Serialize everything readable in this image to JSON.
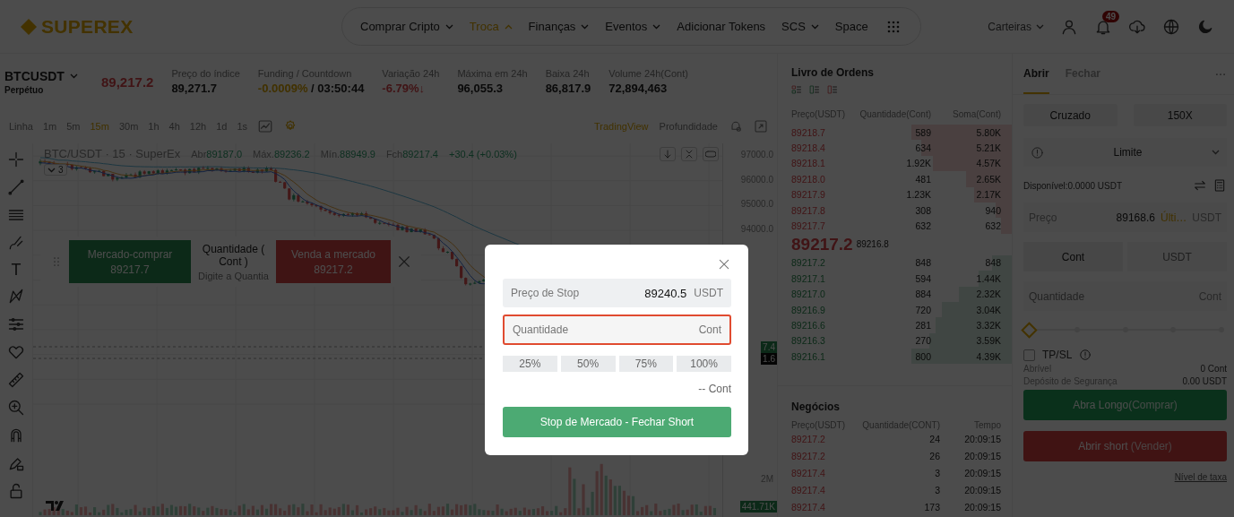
{
  "header": {
    "logo": "SUPEREX",
    "nav": [
      {
        "label": "Comprar Cripto",
        "dropdown": true,
        "selected": false
      },
      {
        "label": "Troca",
        "dropdown": true,
        "selected": true
      },
      {
        "label": "Finanças",
        "dropdown": true,
        "selected": false
      },
      {
        "label": "Eventos",
        "dropdown": true,
        "selected": false
      },
      {
        "label": "Adicionar Tokens",
        "dropdown": false,
        "selected": false
      },
      {
        "label": "SCS",
        "dropdown": true,
        "selected": false
      },
      {
        "label": "Space",
        "dropdown": false,
        "selected": false
      }
    ],
    "wallets": "Carteiras",
    "notification_count": "49"
  },
  "ticker": {
    "symbol": "BTCUSDT",
    "contract_type": "Perpétuo",
    "last_price": "89,217.2",
    "stats": [
      {
        "label": "Preço do índice",
        "value": "89,271.7",
        "kind": "plain"
      },
      {
        "label": "Funding / Countdown",
        "value": "-0.0009%",
        "suffix": "/ 03:50:44",
        "kind": "funding"
      },
      {
        "label": "Variação 24h",
        "value": "-6.79%↓",
        "kind": "down"
      },
      {
        "label": "Máxima em 24h",
        "value": "96,055.3",
        "kind": "plain"
      },
      {
        "label": "Baixa 24h",
        "value": "86,817.9",
        "kind": "plain"
      },
      {
        "label": "Volume 24h(Cont)",
        "value": "72,894,463",
        "kind": "plain"
      }
    ]
  },
  "chart": {
    "intervals": [
      {
        "label": "Linha",
        "selected": false
      },
      {
        "label": "1m",
        "selected": false
      },
      {
        "label": "5m",
        "selected": false
      },
      {
        "label": "15m",
        "selected": true
      },
      {
        "label": "30m",
        "selected": false
      },
      {
        "label": "1h",
        "selected": false
      },
      {
        "label": "4h",
        "selected": false
      },
      {
        "label": "12h",
        "selected": false
      },
      {
        "label": "1d",
        "selected": false
      },
      {
        "label": "1s",
        "selected": false
      }
    ],
    "views": [
      {
        "label": "TradingView",
        "selected": true
      },
      {
        "label": "Profundidade",
        "selected": false
      }
    ],
    "legend": {
      "title": "BTC/USDT · 15 · SuperEx",
      "ohlc": [
        {
          "label": "Abr",
          "value": "89187.0"
        },
        {
          "label": "Máx.",
          "value": "89236.2"
        },
        {
          "label": "Mín.",
          "value": "88949.9"
        },
        {
          "label": "Fch",
          "value": "89217.4"
        }
      ],
      "change": "+30.4 (+0.03%)"
    },
    "indicators_count": "3",
    "text_tool": "T",
    "price_axis": [
      "97000.0",
      "96000.0",
      "95000.0",
      "94000.0"
    ],
    "price_tags": [
      {
        "text": "7.4",
        "kind": "up"
      },
      {
        "text": "1.6",
        "kind": "dark"
      }
    ],
    "volume_axis": "2M",
    "volume_tag": "441.71K",
    "quick_trade": {
      "buy_label": "Mercado-comprar",
      "buy_price": "89217.7",
      "qty_label": "Quantidade ( Cont )",
      "qty_placeholder": "Digite a Quantia",
      "sell_label": "Venda a mercado",
      "sell_price": "89217.2"
    }
  },
  "order_book": {
    "title": "Livro de Ordens",
    "columns": [
      "Preço(USDT)",
      "Quantidade(Cont)",
      "Soma(Cont)"
    ],
    "asks": [
      {
        "price": "89218.7",
        "qty": "589",
        "sum": "5.80K"
      },
      {
        "price": "89218.4",
        "qty": "634",
        "sum": "5.21K"
      },
      {
        "price": "89218.1",
        "qty": "1.92K",
        "sum": "4.57K"
      },
      {
        "price": "89218.0",
        "qty": "481",
        "sum": "2.65K"
      },
      {
        "price": "89217.9",
        "qty": "1.23K",
        "sum": "2.17K"
      },
      {
        "price": "89217.8",
        "qty": "308",
        "sum": "940"
      },
      {
        "price": "89217.7",
        "qty": "632",
        "sum": "632"
      }
    ],
    "last_price": "89217.2",
    "mark_price": "89216.8",
    "bids": [
      {
        "price": "89217.2",
        "qty": "848",
        "sum": "848"
      },
      {
        "price": "89217.1",
        "qty": "594",
        "sum": "1.44K"
      },
      {
        "price": "89217.0",
        "qty": "884",
        "sum": "2.32K"
      },
      {
        "price": "89216.9",
        "qty": "720",
        "sum": "3.04K"
      },
      {
        "price": "89216.6",
        "qty": "281",
        "sum": "3.32K"
      },
      {
        "price": "89216.3",
        "qty": "270",
        "sum": "3.59K"
      },
      {
        "price": "89216.1",
        "qty": "800",
        "sum": "4.39K"
      }
    ]
  },
  "trades": {
    "title": "Negócios",
    "columns": [
      "Preço(USDT)",
      "Quantidade(CONT)",
      "Tempo"
    ],
    "rows": [
      {
        "price": "89217.2",
        "qty": "24",
        "time": "20:09:15"
      },
      {
        "price": "89217.2",
        "qty": "26",
        "time": "20:09:15"
      },
      {
        "price": "89217.4",
        "qty": "3",
        "time": "20:09:15"
      },
      {
        "price": "89217.4",
        "qty": "3",
        "time": "20:09:15"
      },
      {
        "price": "89217.4",
        "qty": "173",
        "time": "20:09:15"
      }
    ]
  },
  "order_form": {
    "tabs": [
      {
        "label": "Abrir",
        "selected": true
      },
      {
        "label": "Fechar",
        "selected": false
      }
    ],
    "margin_mode": "Cruzado",
    "leverage": "150X",
    "order_type": "Limite",
    "available": "Disponível:0.0000 USDT",
    "price": {
      "label": "Preço",
      "value": "89168.6",
      "hint": "Últi…",
      "unit": "USDT"
    },
    "units": [
      {
        "label": "Cont",
        "selected": true
      },
      {
        "label": "USDT",
        "selected": false
      }
    ],
    "quantity": {
      "placeholder": "Quantidade",
      "unit": "Cont"
    },
    "slider": {
      "level": 0
    },
    "tpsl": {
      "label": "TP/SL",
      "checked": false
    },
    "summary": [
      {
        "label": "Abrível",
        "value": "0 Cont"
      },
      {
        "label": "Depósito de Segurança",
        "value": "0.00 USDT"
      }
    ],
    "buy": {
      "label": "Abra Longo",
      "hint": "(Comprar)"
    },
    "sell": {
      "label": "Abrir short",
      "hint": "(Vender)"
    },
    "fee_link": "Nível de taxa"
  },
  "modal": {
    "stop_price": {
      "label": "Preço de Stop",
      "value": "89240.5",
      "unit": "USDT"
    },
    "quantity": {
      "placeholder": "Quantidade",
      "unit": "Cont",
      "focused": true
    },
    "percentages": [
      "25%",
      "50%",
      "75%",
      "100%"
    ],
    "estimate": "-- Cont",
    "submit": "Stop de Mercado - Fechar Short"
  }
}
